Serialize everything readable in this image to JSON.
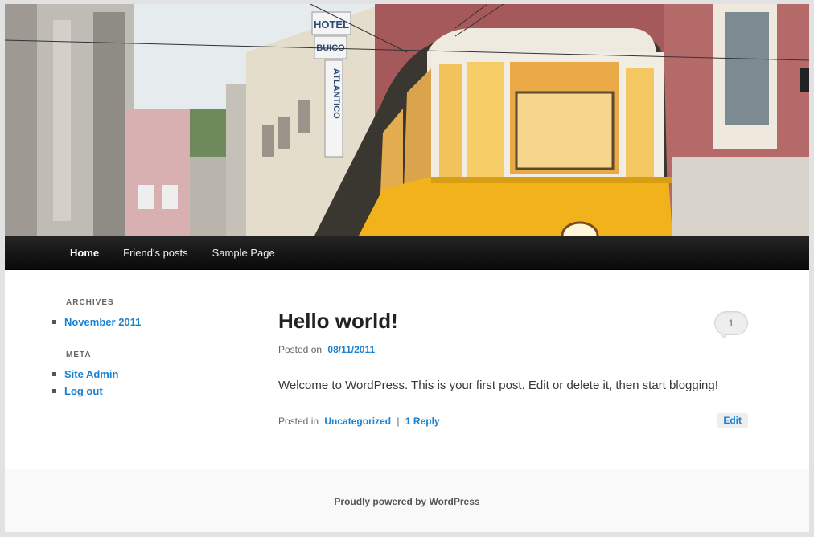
{
  "nav": {
    "items": [
      {
        "label": "Home",
        "current": true
      },
      {
        "label": "Friend's posts",
        "current": false
      },
      {
        "label": "Sample Page",
        "current": false
      }
    ]
  },
  "sidebar": {
    "archives": {
      "title": "Archives",
      "items": [
        "November 2011"
      ]
    },
    "meta": {
      "title": "Meta",
      "items": [
        "Site Admin",
        "Log out"
      ]
    }
  },
  "post": {
    "title": "Hello world!",
    "comment_count": "1",
    "posted_on_label": "Posted on",
    "date": "08/11/2011",
    "content": "Welcome to WordPress. This is your first post. Edit or delete it, then start blogging!",
    "posted_in_label": "Posted in",
    "category": "Uncategorized",
    "separator": "|",
    "reply_link": "1 Reply",
    "edit_label": "Edit"
  },
  "header_sign": {
    "line1": "HOTEL",
    "line2": "BUICO",
    "line3": "ATLANTICO"
  },
  "footer": {
    "credit": "Proudly powered by WordPress"
  },
  "colors": {
    "link": "#1982d1",
    "nav_bg": "#111111",
    "tram_yellow": "#f2b21b"
  }
}
